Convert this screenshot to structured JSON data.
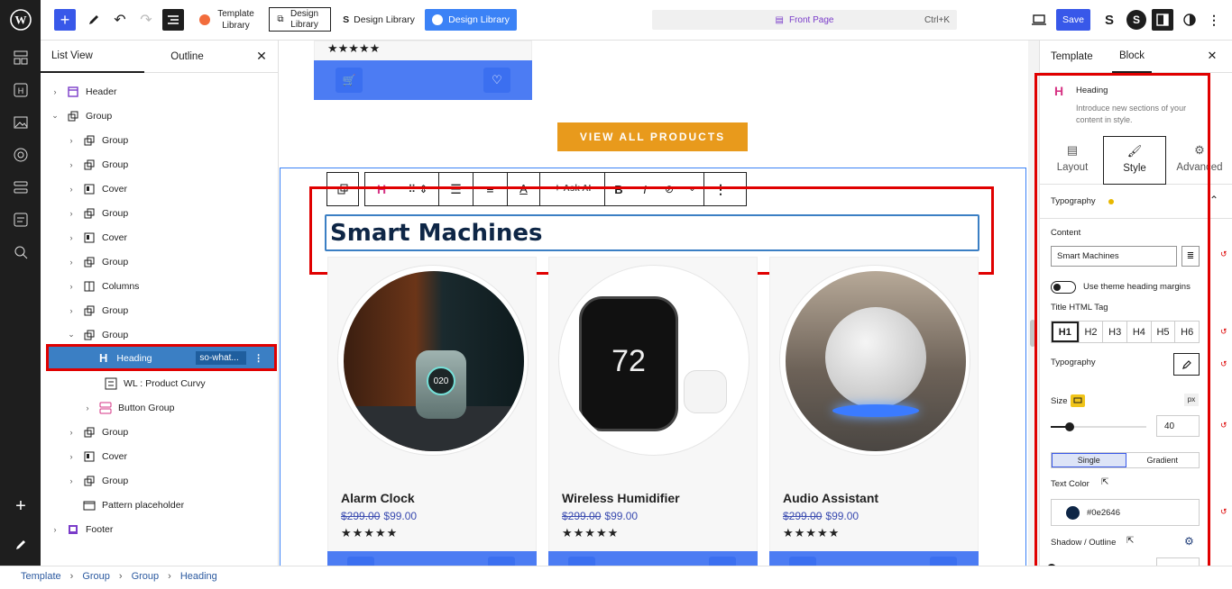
{
  "topbar": {
    "template_library": "Template Library",
    "design_library_1": "Design Library",
    "design_library_2": "Design Library",
    "design_library_3": "Design Library",
    "front_page": "Front Page",
    "shortcut": "Ctrl+K",
    "save": "Save"
  },
  "listview": {
    "tab_list": "List View",
    "tab_outline": "Outline",
    "items": [
      {
        "label": "Header"
      },
      {
        "label": "Group"
      },
      {
        "label": "Group"
      },
      {
        "label": "Group"
      },
      {
        "label": "Cover"
      },
      {
        "label": "Group"
      },
      {
        "label": "Cover"
      },
      {
        "label": "Group"
      },
      {
        "label": "Columns"
      },
      {
        "label": "Group"
      },
      {
        "label": "Group"
      },
      {
        "label": "Heading",
        "badge": "so-what..."
      },
      {
        "label": "WL : Product Curvy"
      },
      {
        "label": "Button Group"
      },
      {
        "label": "Group"
      },
      {
        "label": "Cover"
      },
      {
        "label": "Group"
      },
      {
        "label": "Pattern placeholder"
      },
      {
        "label": "Footer"
      }
    ]
  },
  "canvas": {
    "view_all": "VIEW ALL PRODUCTS",
    "heading": "Smart Machines",
    "ask_ai": "Ask AI",
    "top_stars": "★★★★★",
    "products": [
      {
        "name": "Alarm Clock",
        "old_price": "$299.00",
        "price": "$99.00",
        "stars": "★★★★★",
        "display": "020"
      },
      {
        "name": "Wireless Humidifier",
        "old_price": "$299.00",
        "price": "$99.00",
        "stars": "★★★★★",
        "display": "72"
      },
      {
        "name": "Audio Assistant",
        "old_price": "$299.00",
        "price": "$99.00",
        "stars": "★★★★★"
      }
    ]
  },
  "rightpanel": {
    "tab_template": "Template",
    "tab_block": "Block",
    "block_name": "Heading",
    "block_desc": "Introduce new sections of your content in style.",
    "tab_layout": "Layout",
    "tab_style": "Style",
    "tab_advanced": "Advanced",
    "typography_section": "Typography",
    "content_label": "Content",
    "content_value": "Smart Machines",
    "theme_margins": "Use theme heading margins",
    "title_tag_label": "Title HTML Tag",
    "tags": [
      "H1",
      "H2",
      "H3",
      "H4",
      "H5",
      "H6"
    ],
    "typography_label": "Typography",
    "size_label": "Size",
    "size_unit": "px",
    "size_value": "40",
    "size_fraction": 0.2,
    "single": "Single",
    "gradient": "Gradient",
    "text_color_label": "Text Color",
    "text_color": "#0e2646",
    "shadow_label": "Shadow / Outline"
  },
  "breadcrumb": [
    "Template",
    "Group",
    "Group",
    "Heading"
  ],
  "colors": {
    "accent": "#3858e9",
    "selected_row": "#3b7fc4",
    "highlight": "#e00000",
    "button_orange": "#e89a1c",
    "card_bar": "#4c7cf3"
  }
}
